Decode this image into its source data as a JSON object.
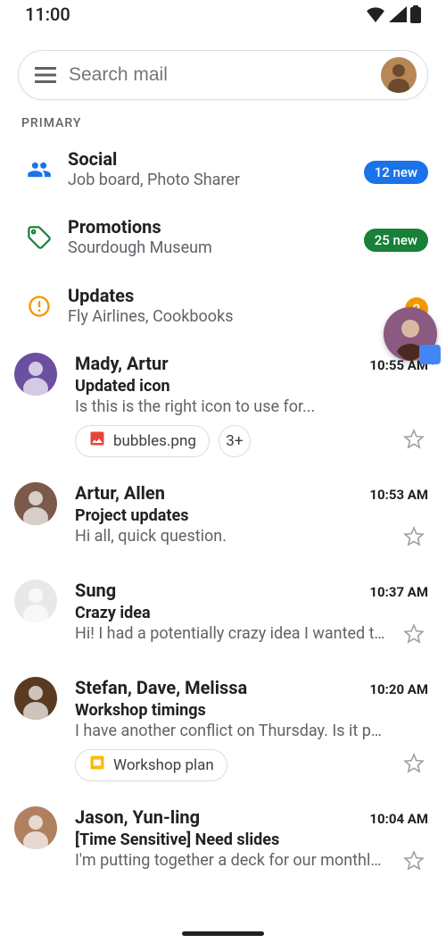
{
  "status": {
    "time": "11:00"
  },
  "search": {
    "placeholder": "Search mail"
  },
  "section": "PRIMARY",
  "categories": [
    {
      "name": "Social",
      "sub": "Job board, Photo Sharer",
      "badge": "12 new",
      "badge_cls": "blue",
      "icon": "social"
    },
    {
      "name": "Promotions",
      "sub": "Sourdough Museum",
      "badge": "25 new",
      "badge_cls": "green",
      "icon": "promotions"
    },
    {
      "name": "Updates",
      "sub": "Fly Airlines, Cookbooks",
      "badge": "2",
      "badge_cls": "orange",
      "icon": "updates"
    }
  ],
  "mails": [
    {
      "sender": "Mady, Artur",
      "time": "10:55 AM",
      "subject": "Updated icon",
      "snippet": "Is this is the right icon to use for...",
      "chips": [
        {
          "label": "bubbles.png",
          "icon": "image"
        }
      ],
      "extra_chip": "3+",
      "avatar": "#6b4fa0"
    },
    {
      "sender": "Artur, Allen",
      "time": "10:53 AM",
      "subject": "Project updates",
      "snippet": "Hi all, quick question.",
      "avatar": "#7b5a4a"
    },
    {
      "sender": "Sung",
      "time": "10:37 AM",
      "subject": "Crazy idea",
      "snippet": "Hi! I had a potentially crazy idea I wanted to…",
      "avatar": "#e8e8e8"
    },
    {
      "sender": "Stefan, Dave, Melissa",
      "time": "10:20 AM",
      "subject": "Workshop timings",
      "snippet": "I have another conflict on Thursday. Is it po…",
      "chips": [
        {
          "label": "Workshop plan",
          "icon": "slides"
        }
      ],
      "avatar": "#5a3a20"
    },
    {
      "sender": "Jason, Yun-ling",
      "time": "10:04 AM",
      "subject": "[Time Sensitive] Need slides",
      "snippet": "I'm putting together a deck for our monthly…",
      "avatar": "#b08060"
    }
  ]
}
